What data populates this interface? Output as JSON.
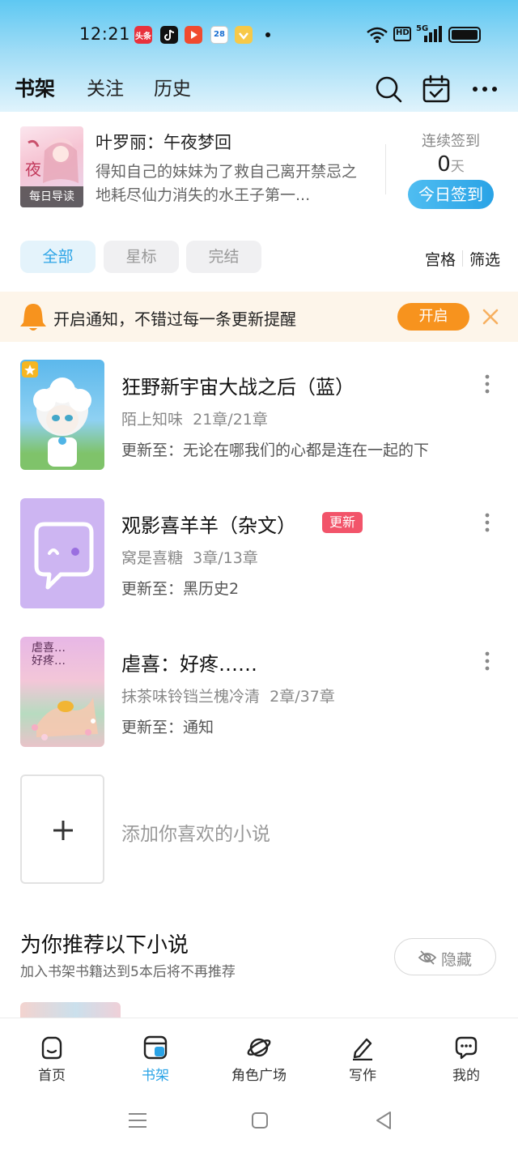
{
  "status_bar": {
    "time": "12:21",
    "app_icons": [
      "toutiao-icon",
      "tiktok-icon",
      "video-icon",
      "calendar-icon",
      "coin-icon"
    ],
    "app_icon_text": {
      "toutiao": "头条",
      "calendar": "28"
    },
    "indicators": [
      "wifi-icon",
      "hd-icon",
      "signal-5g-icon",
      "battery-icon"
    ],
    "hd_label": "HD",
    "network_label": "5G"
  },
  "header": {
    "tabs": [
      {
        "label": "书架",
        "active": true
      },
      {
        "label": "关注",
        "active": false
      },
      {
        "label": "历史",
        "active": false
      }
    ],
    "icons": [
      "search-icon",
      "calendar-check-icon",
      "more-icon"
    ]
  },
  "daily": {
    "badge": "每日导读",
    "title": "叶罗丽：午夜梦回",
    "description": "得知自己的妹妹为了救自己离开禁忌之地耗尽仙力消失的水王子第一...",
    "checkin_label": "连续签到",
    "checkin_days": "0",
    "checkin_unit": "天",
    "checkin_button": "今日签到"
  },
  "filters": {
    "items": [
      {
        "label": "全部",
        "active": true
      },
      {
        "label": "星标",
        "active": false
      },
      {
        "label": "完结",
        "active": false
      }
    ],
    "grid_label": "宫格",
    "filter_label": "筛选"
  },
  "notice": {
    "text": "开启通知，不错过每一条更新提醒",
    "button": "开启"
  },
  "books": [
    {
      "title": "狂野新宇宙大战之后（蓝）",
      "author": "陌上知味",
      "progress": "21章/21章",
      "update": "更新至：无论在哪我们的心都是连在一起的下",
      "tag": "",
      "starred": true
    },
    {
      "title": "观影喜羊羊（杂文）",
      "author": "窝是喜糖",
      "progress": "3章/13章",
      "update": "更新至：黑历史2",
      "tag": "更新",
      "starred": false
    },
    {
      "title": "虐喜：好疼……",
      "author": "抹茶味铃铛兰槐冷清",
      "progress": "2章/37章",
      "update": "更新至：通知",
      "tag": "",
      "starred": false
    }
  ],
  "book3_cover_text": "虐喜…\n好疼…",
  "add_label": "添加你喜欢的小说",
  "recommend": {
    "title": "为你推荐以下小说",
    "subtitle": "加入书架书籍达到5本后将不再推荐",
    "hide_button": "隐藏"
  },
  "bottom_nav": [
    {
      "label": "首页",
      "icon": "home-icon",
      "active": false
    },
    {
      "label": "书架",
      "icon": "bookshelf-icon",
      "active": true
    },
    {
      "label": "角色广场",
      "icon": "planet-icon",
      "active": false
    },
    {
      "label": "写作",
      "icon": "pen-icon",
      "active": false
    },
    {
      "label": "我的",
      "icon": "chat-bubble-icon",
      "active": false
    }
  ],
  "colors": {
    "accent": "#2aa3e6",
    "notice_orange": "#f7931e",
    "tag_red": "#f2546a",
    "notice_bg": "#fdf5ea"
  }
}
